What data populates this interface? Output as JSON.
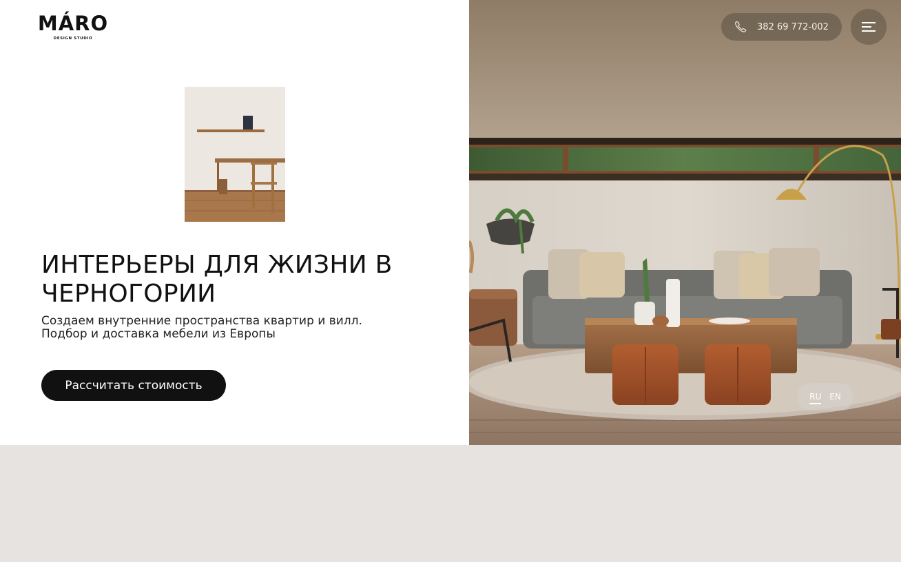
{
  "header": {
    "logo_name": "MÁRO",
    "logo_sub": "DESIGN STUDIO",
    "phone": "382 69 772-002"
  },
  "hero": {
    "headline": "ИНТЕРЬЕРЫ ДЛЯ ЖИЗНИ В ЧЕРНОГОРИИ",
    "subtext_line1": "Создаем внутренние пространства квартир и вилл.",
    "subtext_line2": "Подбор и доставка мебели из Европы",
    "cta_label": "Рассчитать стоимость"
  },
  "languages": {
    "active": "RU",
    "other": "EN"
  },
  "icons": {
    "phone": "phone-icon",
    "menu": "menu-icon"
  },
  "colors": {
    "cta_bg": "#111111",
    "footer_band": "#e6e3e1"
  }
}
